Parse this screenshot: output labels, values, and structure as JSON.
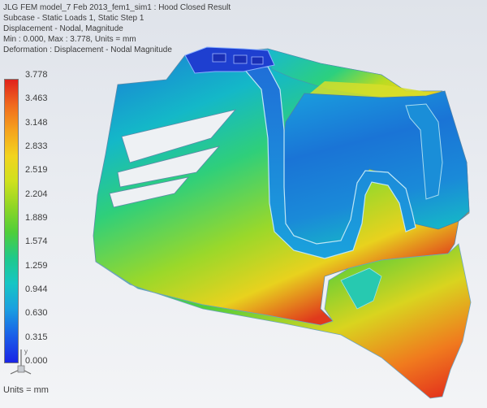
{
  "header": {
    "line1": "JLG FEM model_7 Feb 2013_fem1_sim1 : Hood Closed Result",
    "line2": "Subcase - Static Loads 1, Static Step 1",
    "line3": "Displacement - Nodal, Magnitude",
    "line4": "Min : 0.000, Max : 3.778, Units = mm",
    "line5": "Deformation : Displacement - Nodal Magnitude"
  },
  "legend": {
    "ticks": [
      "3.778",
      "3.463",
      "3.148",
      "2.833",
      "2.519",
      "2.204",
      "1.889",
      "1.574",
      "1.259",
      "0.944",
      "0.630",
      "0.315",
      "0.000"
    ],
    "units": "Units = mm",
    "colors": {
      "max": "#e0221c",
      "mid": "#4fce3a",
      "min": "#1a24e6"
    }
  },
  "model": {
    "icon": "fem-hood-contour-model"
  },
  "triad": {
    "axis_label": "y",
    "icon": "coordinate-triad-icon"
  }
}
